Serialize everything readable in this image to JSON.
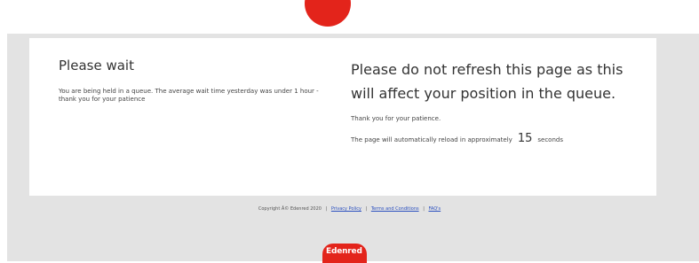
{
  "left": {
    "title": "Please wait",
    "message": "You are being held in a queue. The average wait time yesterday was under 1 hour - thank you for your patience"
  },
  "right": {
    "warning": "Please do not refresh this page as this will affect your position in the queue.",
    "thanks": "Thank you for your patience.",
    "reload_prefix": "The page will automatically reload in approximately",
    "seconds": "15",
    "reload_suffix": "seconds"
  },
  "footer": {
    "copyright": "Copyright Â© Edenred 2020",
    "links": [
      "Privacy Policy",
      "Terms and Conditions",
      "FAQ's"
    ],
    "separator": "|"
  },
  "brand": {
    "name": "Edenred",
    "color": "#e3241b"
  }
}
